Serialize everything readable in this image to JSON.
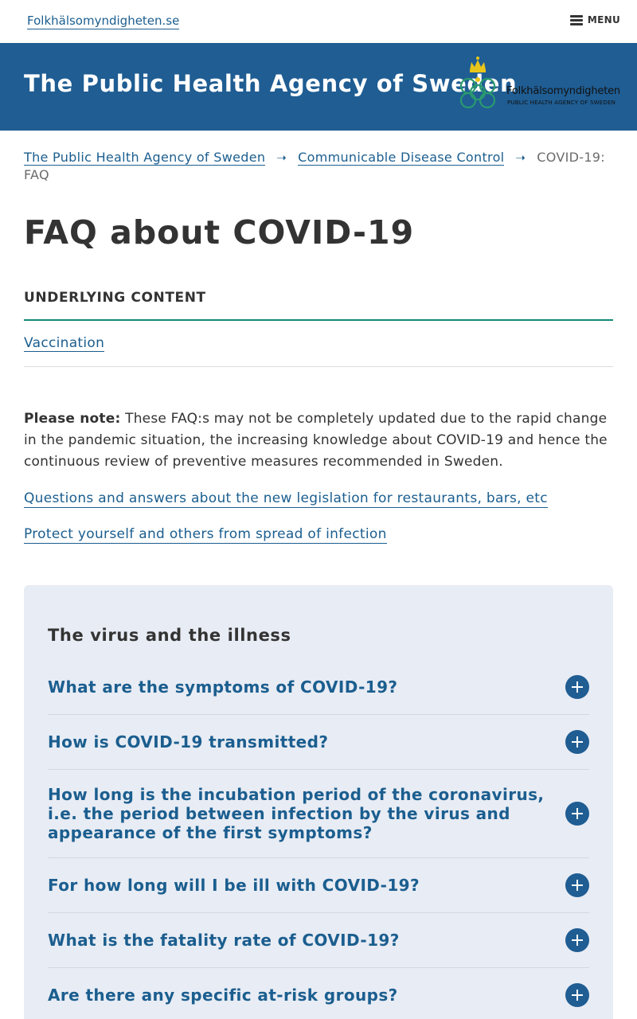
{
  "topbar": {
    "site_link": "Folkhälsomyndigheten.se",
    "menu_label": "MENU"
  },
  "banner": {
    "title": "The Public Health Agency of Sweden",
    "logo_name": "Folkhälsomyndigheten",
    "logo_subtitle": "PUBLIC HEALTH AGENCY OF SWEDEN"
  },
  "breadcrumb": {
    "items": [
      "The Public Health Agency of Sweden",
      "Communicable Disease Control"
    ],
    "current": "COVID-19: FAQ"
  },
  "page": {
    "title": "FAQ about COVID-19"
  },
  "underlying": {
    "heading": "UNDERLYING CONTENT",
    "links": [
      "Vaccination"
    ]
  },
  "note": {
    "label": "Please note:",
    "text": "These FAQ:s may not be completely updated due to the rapid change in the pandemic situation, the increasing knowledge about COVID-19 and hence the continuous review of preventive measures recommended in Sweden."
  },
  "links": [
    "Questions and answers about the new legislation for restaurants, bars, etc",
    "Protect yourself and others from spread of infection"
  ],
  "faq": {
    "section_title": "The virus and the illness",
    "questions": [
      "What are the symptoms of COVID-19?",
      "How is COVID-19 transmitted?",
      "How long is the incubation period of the coronavirus, i.e. the period between infection by the virus and appearance of the first symptoms?",
      "For how long will I be ill with COVID-19?",
      "What is the fatality rate of COVID-19?",
      "Are there any specific at-risk groups?"
    ]
  },
  "colors": {
    "banner": "#1f5d93",
    "link": "#1b5e8f",
    "accent_rule": "#138a78",
    "faq_background": "#e8ecf4"
  }
}
